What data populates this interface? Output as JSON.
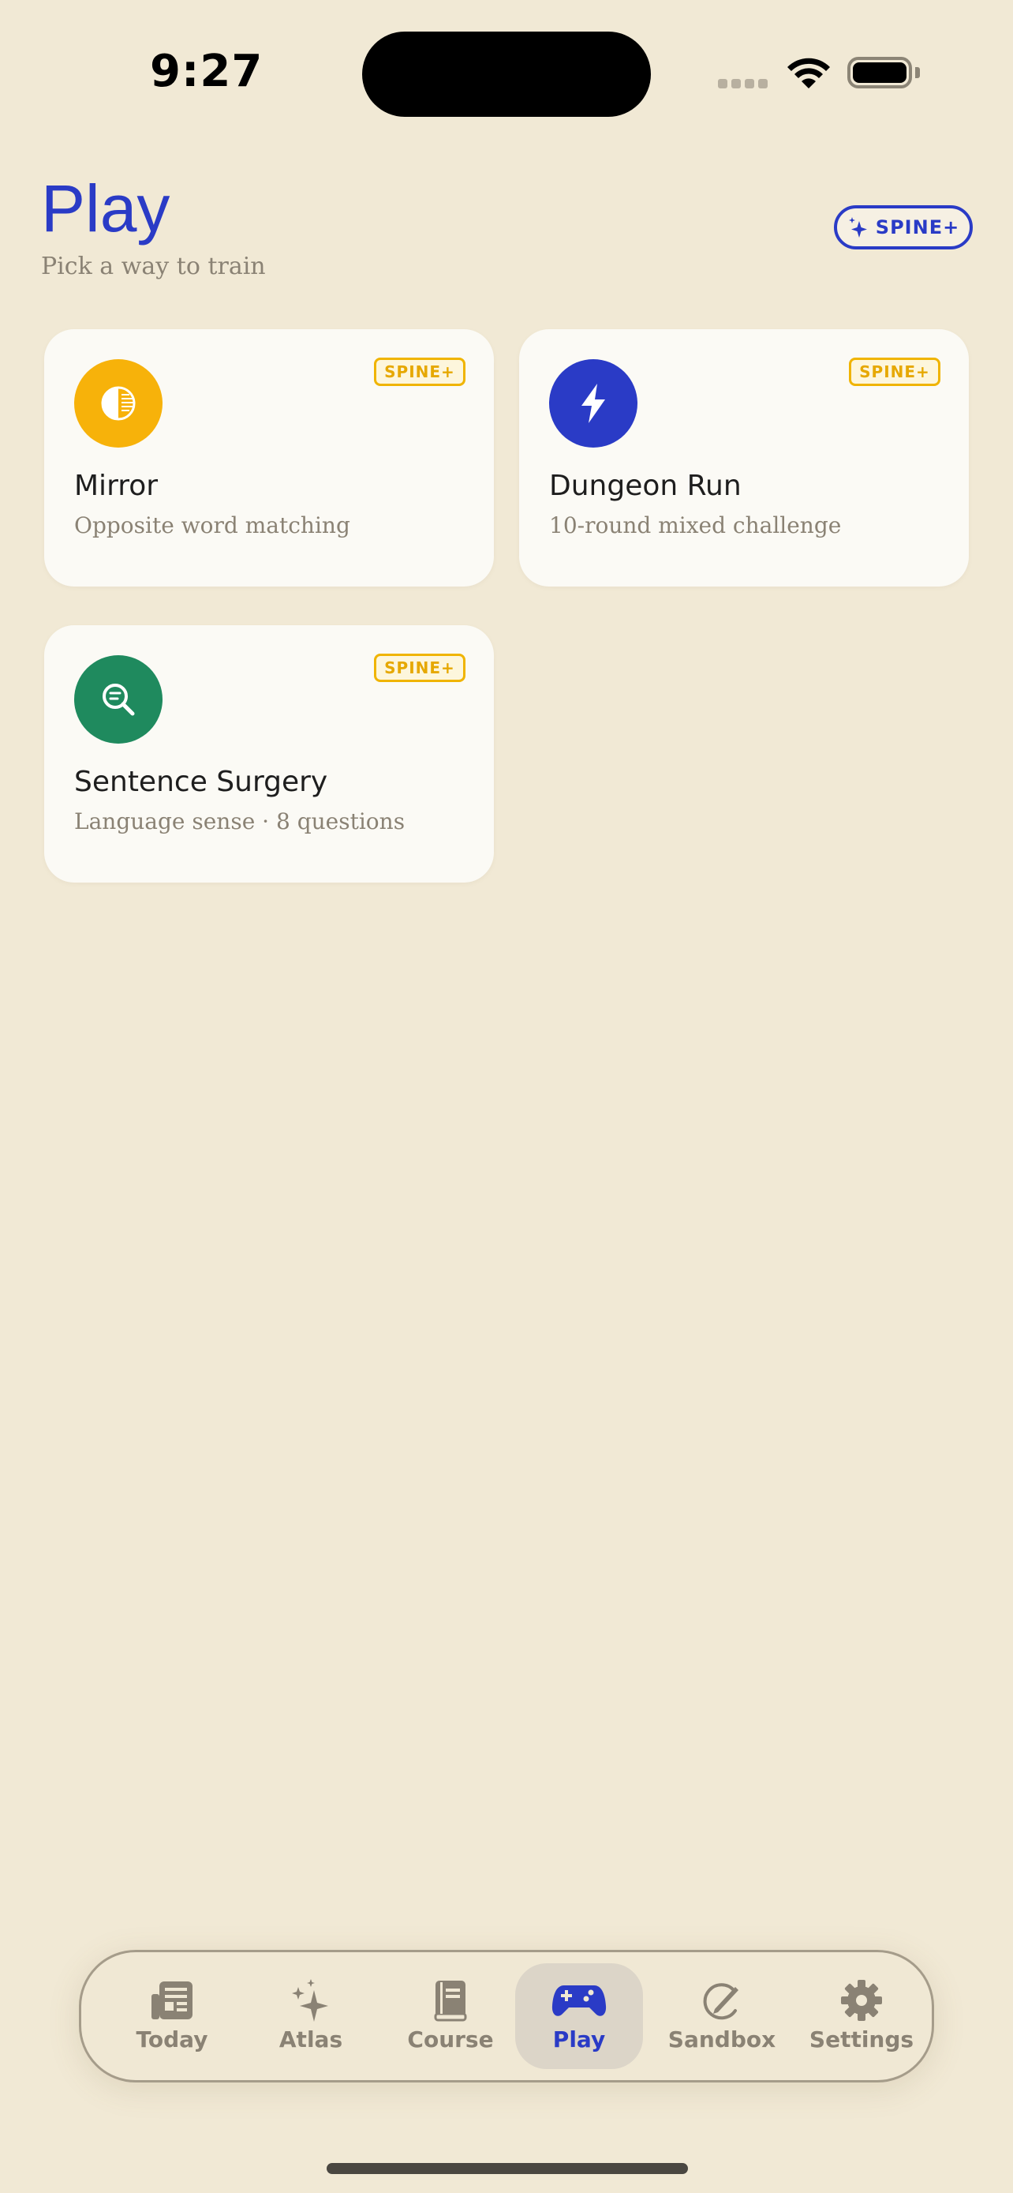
{
  "status_bar": {
    "time": "9:27"
  },
  "header": {
    "title": "Play",
    "subtitle": "Pick a way to train",
    "badge_label": "SPINE+"
  },
  "cards": [
    {
      "title": "Mirror",
      "subtitle": "Opposite word matching",
      "badge": "SPINE+",
      "icon": "half-circle-icon",
      "icon_color": "#F7B20A"
    },
    {
      "title": "Dungeon Run",
      "subtitle": "10-round mixed challenge",
      "badge": "SPINE+",
      "icon": "lightning-bolt-icon",
      "icon_color": "#2A3BC6"
    },
    {
      "title": "Sentence Surgery",
      "subtitle": "Language sense · 8 questions",
      "badge": "SPINE+",
      "icon": "magnifier-text-icon",
      "icon_color": "#1F8A5E"
    }
  ],
  "tabbar": {
    "items": [
      {
        "label": "Today",
        "icon": "newspaper-icon"
      },
      {
        "label": "Atlas",
        "icon": "sparkles-icon"
      },
      {
        "label": "Course",
        "icon": "book-icon"
      },
      {
        "label": "Play",
        "icon": "gamecontroller-icon",
        "active": true
      },
      {
        "label": "Sandbox",
        "icon": "pencil-circle-icon"
      },
      {
        "label": "Settings",
        "icon": "gear-icon"
      }
    ]
  },
  "colors": {
    "background": "#F1E9D5",
    "accent": "#2A3BC6",
    "badge": "#F0B400",
    "muted_text": "#8A8274"
  }
}
